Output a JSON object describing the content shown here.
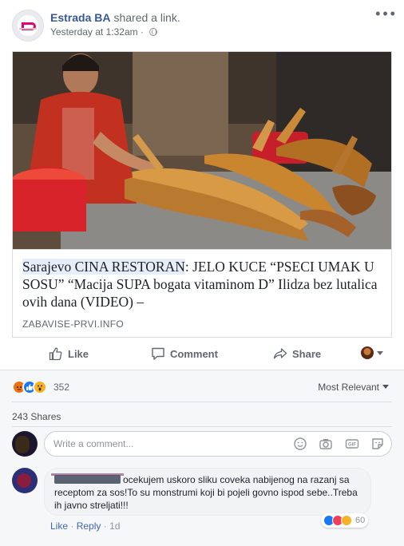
{
  "post": {
    "author": "Estrada BA",
    "action": "shared a link.",
    "timestamp": "Yesterday at 1:32am",
    "separator": "·",
    "more_icon": "ellipsis-icon",
    "privacy_icon": "globe-icon"
  },
  "link": {
    "title_highlight": "Sarajevo CINA RESTORAN",
    "title_rest": ": JELO KUCE “PSECI UMAK U SOSU” “Macija SUPA bogata vitaminom D” Ilidza bez lutalica ovih dana (VIDEO) –",
    "domain": "ZABAVISE-PRVI.INFO"
  },
  "actions": {
    "like": "Like",
    "comment": "Comment",
    "share": "Share"
  },
  "feedback": {
    "reaction_count": "352",
    "reaction_types": [
      "angry",
      "like",
      "wow"
    ],
    "sort_label": "Most Relevant",
    "shares": "243 Shares",
    "composer_placeholder": "Write a comment...",
    "composer_icons": [
      "emoji-icon",
      "camera-icon",
      "gif-icon",
      "sticker-icon"
    ]
  },
  "comment": {
    "text": "ocekujem uskoro sliku coveka nabijenog na razanj sa receptom za sos!To su monstrumi koji bi pojeli govno ispod sebe..Treba ih javno streljati!!!",
    "like_label": "Like",
    "reply_label": "Reply",
    "age": "1d",
    "reaction_count": "60",
    "reaction_types": [
      "like",
      "love",
      "haha"
    ]
  },
  "colors": {
    "link_blue": "#365899",
    "meta_gray": "#616770",
    "brand_blue": "#4267b2",
    "feedback_bg": "#f6f7f9"
  }
}
